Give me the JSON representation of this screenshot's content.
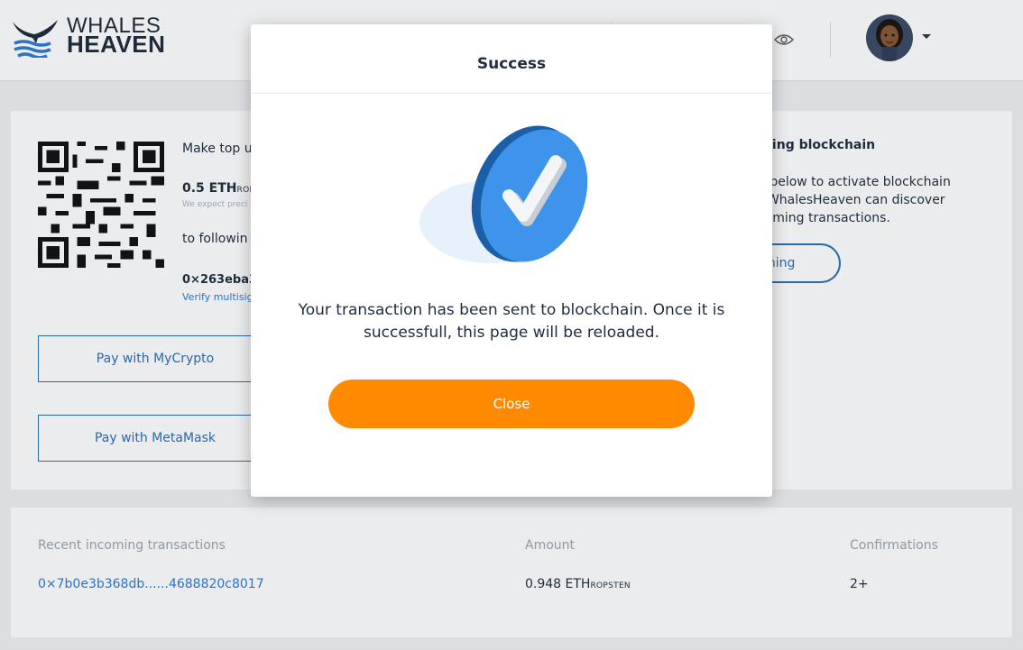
{
  "brand": {
    "line1": "WHALES",
    "line2": "HEAVEN"
  },
  "header": {
    "eye_icon": "eye-icon",
    "avatar": "user-avatar"
  },
  "topup": {
    "intro": "Make top u",
    "amount": "0.5 ETH",
    "amount_unit": "ROP",
    "note": "We expect preci",
    "to_following": "to followin",
    "address": "0×263eba3",
    "verify_link": "Verify multisig",
    "pay_mycrypto": "Pay with MyCrypto",
    "pay_metamask": "Pay with MetaMask"
  },
  "blockchain_panel": {
    "title": "nning blockchain",
    "text_lines": [
      "n below to activate blockchain",
      "t WhalesHeaven can discover",
      "coming transactions."
    ],
    "button": "nning"
  },
  "transactions": {
    "headers": [
      "Recent incoming transactions",
      "Amount",
      "Confirmations"
    ],
    "rows": [
      {
        "hash": "0×7b0e3b368db......4688820c8017",
        "amount": "0.948 ETH",
        "unit": "ROPSTEN",
        "confirmations": "2+"
      }
    ]
  },
  "modal": {
    "title": "Success",
    "message": "Your transaction has been sent to blockchain. Once it is successfull, this page will be reloaded.",
    "close_label": "Close",
    "icon": "check-circle-icon"
  },
  "colors": {
    "accent_orange": "#ff8a00",
    "link_blue": "#2b7bd6",
    "button_blue": "#2e6db4"
  }
}
